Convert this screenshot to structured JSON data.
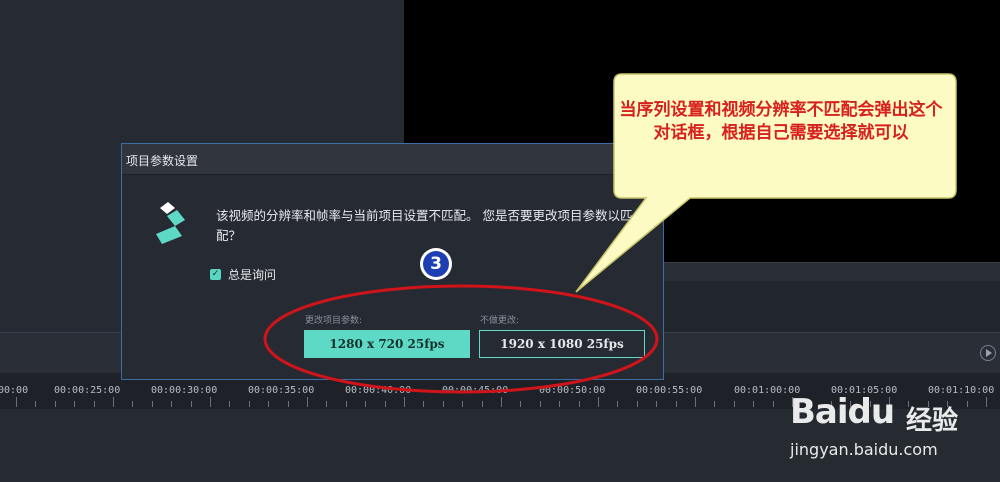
{
  "dialog": {
    "title": "项目参数设置",
    "message": "该视频的分辨率和帧率与当前项目设置不匹配。 您是否要更改项目参数以匹配？",
    "always_ask_label": "总是询问",
    "always_ask_checked": true,
    "change_option_label": "更改项目参数:",
    "change_button_label": "1280 x 720 25fps",
    "keep_option_label": "不做更改:",
    "keep_button_label": "1920 x 1080 25fps"
  },
  "timeline": {
    "ticks": [
      "00:00",
      "00:00:25:00",
      "00:00:30:00",
      "00:00:35:00",
      "00:00:40:00",
      "00:00:45:00",
      "00:00:50:00",
      "00:00:55:00",
      "00:01:00:00",
      "00:01:05:00",
      "00:01:10:00"
    ]
  },
  "annotation": {
    "callout_text": "当序列设置和视频分辨率不匹配会弹出这个对话框，根据自己需要选择就可以",
    "step_number": "3",
    "callout_color": "#d8201c",
    "callout_fill": "#fdfbc4",
    "ellipse_color": "#d0141a"
  },
  "watermark": {
    "brand": "Baidu",
    "product": "经验",
    "url": "jingyan.baidu.com"
  },
  "colors": {
    "accent": "#5ed9c6",
    "dialog_border": "#3a6ea5"
  },
  "icons": {
    "app_logo": "filmora-logo-icon",
    "checkbox": "checkbox-checked-icon",
    "play": "play-icon"
  }
}
